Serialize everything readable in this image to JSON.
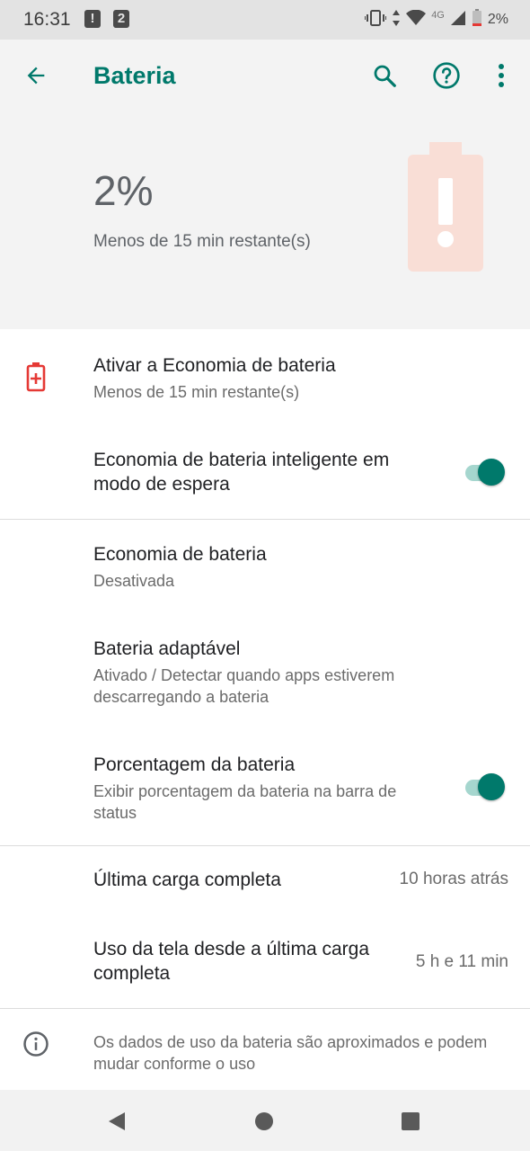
{
  "status_bar": {
    "time": "16:31",
    "notif_1": "!",
    "notif_2": "2",
    "network": "4G",
    "battery_percent": "2%"
  },
  "toolbar": {
    "title": "Bateria",
    "icons": [
      "back-arrow-icon",
      "search-icon",
      "help-icon",
      "more-vert-icon"
    ]
  },
  "battery_header": {
    "percent": "2%",
    "remaining": "Menos de 15 min restante(s)",
    "alert_color": "#f9ded6"
  },
  "items": [
    {
      "title": "Ativar a Economia de bateria",
      "subtitle": "Menos de 15 min restante(s)",
      "icon": "battery-saver-icon"
    },
    {
      "title": "Economia de bateria inteligente em modo de espera",
      "toggle": true
    },
    {
      "title": "Economia de bateria",
      "subtitle": "Desativada"
    },
    {
      "title": "Bateria adaptável",
      "subtitle": "Ativado / Detectar quando apps estiverem descarregando a bateria"
    },
    {
      "title": "Porcentagem da bateria",
      "subtitle": "Exibir porcentagem da bateria na barra de status",
      "toggle": true
    },
    {
      "title": "Última carga completa",
      "value": "10 horas atrás"
    },
    {
      "title": "Uso da tela desde a última carga completa",
      "value": "5 h e 11 min"
    }
  ],
  "footer": {
    "info": "Os dados de uso da bateria são aproximados e podem mudar conforme o uso"
  },
  "colors": {
    "accent": "#00796b",
    "toggle_track": "#a5d6ce",
    "battery_alert": "#e53935"
  }
}
